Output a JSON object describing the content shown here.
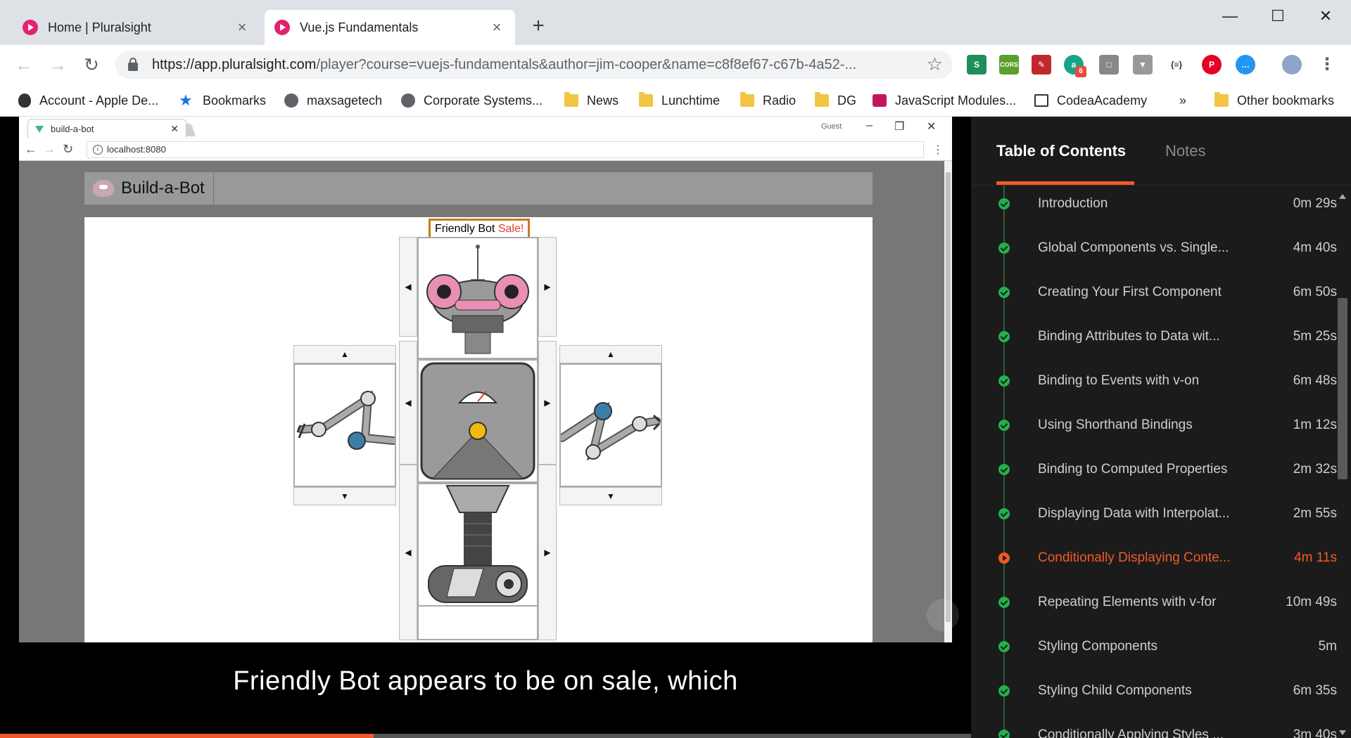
{
  "browser": {
    "tabs": [
      {
        "label": "Home | Pluralsight",
        "active": false
      },
      {
        "label": "Vue.js Fundamentals",
        "active": true
      }
    ],
    "url_host": "https://app.pluralsight.com",
    "url_rest": "/player?course=vuejs-fundamentals&author=jim-cooper&name=c8f8ef67-c67b-4a52-...",
    "extension_badge": "6",
    "extension_cors": "CORS"
  },
  "bookmarks": [
    {
      "label": "Account - Apple De...",
      "icon": "apple-icon"
    },
    {
      "label": "Bookmarks",
      "icon": "star-icon"
    },
    {
      "label": "maxsagetech",
      "icon": "globe-icon"
    },
    {
      "label": "Corporate Systems...",
      "icon": "globe-icon"
    },
    {
      "label": "News",
      "icon": "folder-icon"
    },
    {
      "label": "Lunchtime",
      "icon": "folder-icon"
    },
    {
      "label": "Radio",
      "icon": "folder-icon"
    },
    {
      "label": "DG",
      "icon": "folder-icon"
    },
    {
      "label": "JavaScript Modules...",
      "icon": "site-icon"
    },
    {
      "label": "CodeaAcademy",
      "icon": "site-icon"
    },
    {
      "label": "»",
      "icon": "chevron-icon"
    },
    {
      "label": "Other bookmarks",
      "icon": "folder-icon"
    }
  ],
  "inner_browser": {
    "tab_label": "build-a-bot",
    "guest": "Guest",
    "url": "localhost:8080"
  },
  "app": {
    "brand": "Build-a-Bot",
    "bot_name": "Friendly Bot",
    "sale_text": "Sale!"
  },
  "caption": "Friendly Bot appears to be on sale, which",
  "progress_fraction": 0.385,
  "sidebar": {
    "tab_toc": "Table of Contents",
    "tab_notes": "Notes",
    "items": [
      {
        "title": "Introduction",
        "duration": "0m 29s",
        "status": "done"
      },
      {
        "title": "Global Components vs. Single...",
        "duration": "4m 40s",
        "status": "done"
      },
      {
        "title": "Creating Your First Component",
        "duration": "6m 50s",
        "status": "done"
      },
      {
        "title": "Binding Attributes to Data wit...",
        "duration": "5m 25s",
        "status": "done"
      },
      {
        "title": "Binding to Events with v-on",
        "duration": "6m 48s",
        "status": "done"
      },
      {
        "title": "Using Shorthand Bindings",
        "duration": "1m 12s",
        "status": "done"
      },
      {
        "title": "Binding to Computed Properties",
        "duration": "2m 32s",
        "status": "done"
      },
      {
        "title": "Displaying Data with Interpolat...",
        "duration": "2m 55s",
        "status": "done"
      },
      {
        "title": "Conditionally Displaying Conte...",
        "duration": "4m 11s",
        "status": "current"
      },
      {
        "title": "Repeating Elements with v-for",
        "duration": "10m 49s",
        "status": "done"
      },
      {
        "title": "Styling Components",
        "duration": "5m",
        "status": "done"
      },
      {
        "title": "Styling Child Components",
        "duration": "6m 35s",
        "status": "done"
      },
      {
        "title": "Conditionally Applying Styles ...",
        "duration": "3m 40s",
        "status": "done"
      }
    ]
  },
  "colors": {
    "accent": "#f05a28",
    "complete": "#23b14d",
    "sale": "#e03b2a"
  }
}
